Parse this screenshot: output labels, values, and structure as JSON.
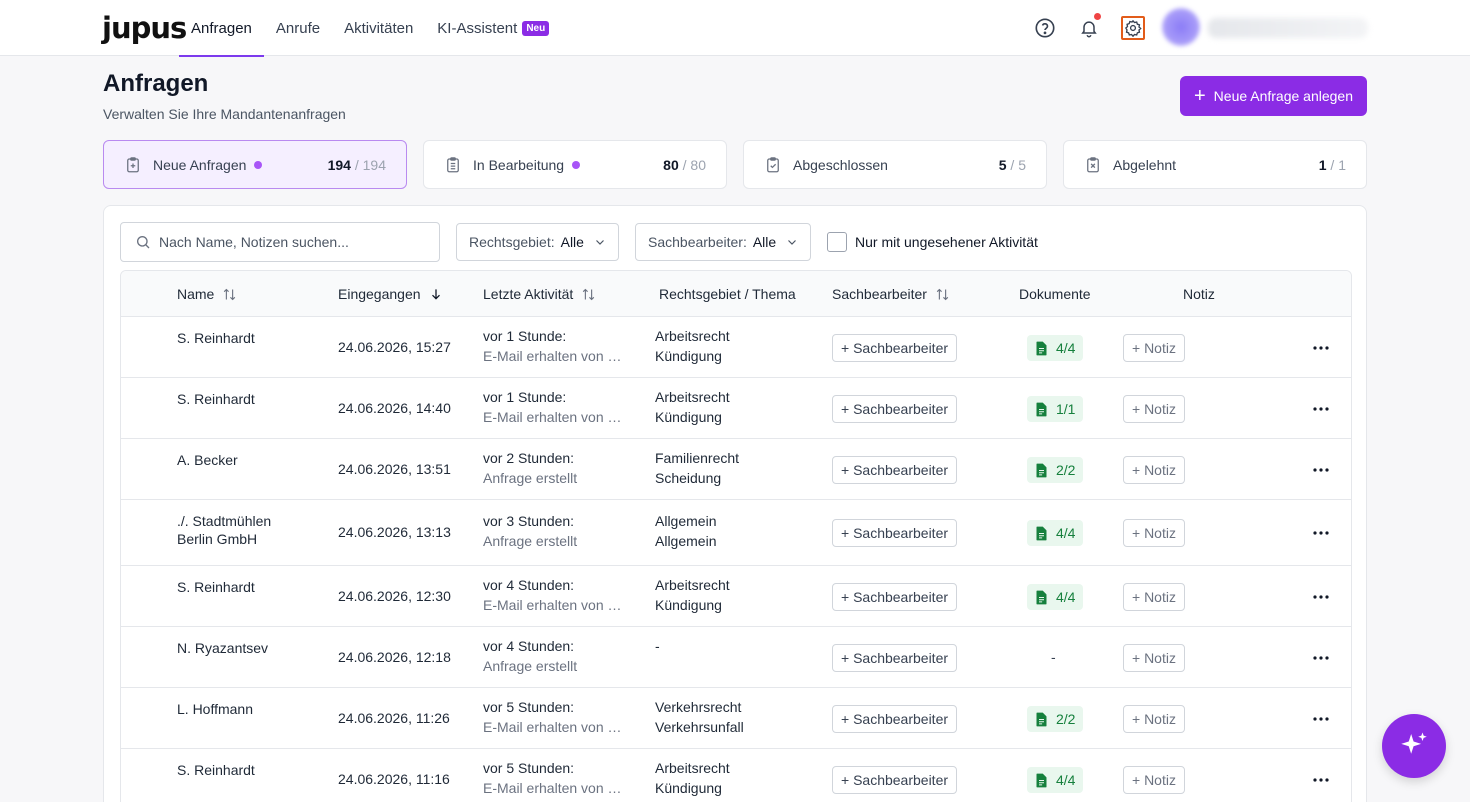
{
  "nav": {
    "logo": "jupus",
    "items": [
      {
        "label": "Anfragen",
        "active": true
      },
      {
        "label": "Anrufe",
        "active": false
      },
      {
        "label": "Aktivitäten",
        "active": false
      },
      {
        "label": "KI-Assistent",
        "active": false,
        "badge": "Neu"
      }
    ],
    "icons": [
      "help-icon",
      "bell-icon",
      "gear-icon"
    ]
  },
  "header": {
    "title": "Anfragen",
    "subtitle": "Verwalten Sie Ihre Mandantenanfragen",
    "primary_button": "Neue Anfrage anlegen"
  },
  "status_cards": [
    {
      "label": "Neue Anfragen",
      "count": "194",
      "total": "/ 194",
      "dot": true,
      "active": true
    },
    {
      "label": "In Bearbeitung",
      "count": "80",
      "total": "/ 80",
      "dot": true,
      "active": false
    },
    {
      "label": "Abgeschlossen",
      "count": "5",
      "total": "/ 5",
      "dot": false,
      "active": false
    },
    {
      "label": "Abgelehnt",
      "count": "1",
      "total": "/ 1",
      "dot": false,
      "active": false
    }
  ],
  "filters": {
    "search_placeholder": "Nach Name, Notizen suchen...",
    "rechtsgebiet_label": "Rechtsgebiet:",
    "rechtsgebiet_value": "Alle",
    "sachbearbeiter_label": "Sachbearbeiter:",
    "sachbearbeiter_value": "Alle",
    "checkbox_label": "Nur mit ungesehener Aktivität"
  },
  "table": {
    "columns": {
      "name": "Name",
      "eingegangen": "Eingegangen",
      "aktivitaet": "Letzte Aktivität",
      "thema": "Rechtsgebiet / Thema",
      "sachbearbeiter": "Sachbearbeiter",
      "dokumente": "Dokumente",
      "notiz": "Notiz"
    },
    "sb_button": "+ Sachbearbeiter",
    "note_button": "+ Notiz",
    "rows": [
      {
        "name": "S. Reinhardt",
        "date": "24.06.2026, 15:27",
        "act1": "vor 1 Stunde:",
        "act2": "E-Mail erhalten von …",
        "area1": "Arbeitsrecht",
        "area2": "Kündigung",
        "docs": "4/4"
      },
      {
        "name": "S. Reinhardt",
        "date": "24.06.2026, 14:40",
        "act1": "vor 1 Stunde:",
        "act2": "E-Mail erhalten von …",
        "area1": "Arbeitsrecht",
        "area2": "Kündigung",
        "docs": "1/1"
      },
      {
        "name": "A. Becker",
        "date": "24.06.2026, 13:51",
        "act1": "vor 2 Stunden:",
        "act2": "Anfrage erstellt",
        "area1": "Familienrecht",
        "area2": "Scheidung",
        "docs": "2/2"
      },
      {
        "name": "./. Stadtmühlen Berlin GmbH",
        "date": "24.06.2026, 13:13",
        "act1": "vor 3 Stunden:",
        "act2": "Anfrage erstellt",
        "area1": "Allgemein",
        "area2": "Allgemein",
        "docs": "4/4"
      },
      {
        "name": "S. Reinhardt",
        "date": "24.06.2026, 12:30",
        "act1": "vor 4 Stunden:",
        "act2": "E-Mail erhalten von …",
        "area1": "Arbeitsrecht",
        "area2": "Kündigung",
        "docs": "4/4"
      },
      {
        "name": "N. Ryazantsev",
        "date": "24.06.2026, 12:18",
        "act1": "vor 4 Stunden:",
        "act2": "Anfrage erstellt",
        "area1": "-",
        "area2": "",
        "docs": "-"
      },
      {
        "name": "L. Hoffmann",
        "date": "24.06.2026, 11:26",
        "act1": "vor 5 Stunden:",
        "act2": "E-Mail erhalten von …",
        "area1": "Verkehrsrecht",
        "area2": "Verkehrsunfall",
        "docs": "2/2"
      },
      {
        "name": "S. Reinhardt",
        "date": "24.06.2026, 11:16",
        "act1": "vor 5 Stunden:",
        "act2": "E-Mail erhalten von …",
        "area1": "Arbeitsrecht",
        "area2": "Kündigung",
        "docs": "4/4"
      }
    ]
  },
  "colors": {
    "accent": "#8b2ce5",
    "docs_green": "#16803d",
    "notification": "#ef4444"
  }
}
